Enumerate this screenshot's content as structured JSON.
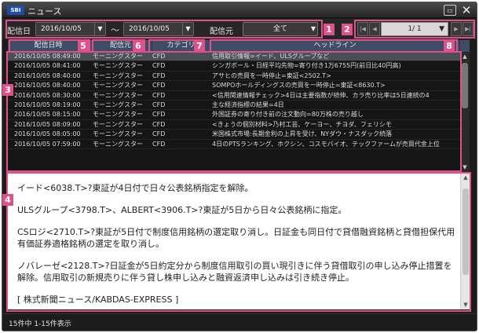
{
  "window": {
    "title": "ニュース",
    "logo": "SBI"
  },
  "filters": {
    "date_label": "配信日",
    "date_from": "2016/10/05",
    "tilde": "〜",
    "date_to": "2016/10/05",
    "source_label": "配信元",
    "source_value": "全て"
  },
  "pager": {
    "value": "1/ 1"
  },
  "columns": [
    "配信日時",
    "配信元",
    "カテゴリ",
    "ヘッドライン"
  ],
  "rows": [
    {
      "date": "2016/10/05 08:49:00",
      "source": "モーニングスター",
      "category": "CFD",
      "headline": "信用取引情報=イード、ULSグループなど",
      "selected": true
    },
    {
      "date": "2016/10/05 08:41:00",
      "source": "モーニングスター",
      "category": "CFD",
      "headline": "シンガポール・日経平均先物=寄り付き1万6755円(前日比40円高)"
    },
    {
      "date": "2016/10/05 08:40:00",
      "source": "モーニングスター",
      "category": "CFD",
      "headline": "アサヒの売買を一時停止=東証<2502.T>"
    },
    {
      "date": "2016/10/05 08:40:00",
      "source": "モーニングスター",
      "category": "CFD",
      "headline": "SOMPOホールディングスの売買を一時停止=東証<8630.T>"
    },
    {
      "date": "2016/10/05 08:30:00",
      "source": "モーニングスター",
      "category": "CFD",
      "headline": "<信用関連情報チェック>4日は主要指数が続伸、カラ売り比率は5日連続の4"
    },
    {
      "date": "2016/10/05 08:19:00",
      "source": "モーニングスター",
      "category": "CFD",
      "headline": "主な経済指標の結果=4日"
    },
    {
      "date": "2016/10/05 08:15:00",
      "source": "モーニングスター",
      "category": "CFD",
      "headline": "外国証券の寄り付き前の注文動向=80万株の売り越し"
    },
    {
      "date": "2016/10/05 08:09:00",
      "source": "モーニングスター",
      "category": "CFD",
      "headline": "<きょうの個別材料>乃村工芸、ケーヨー、チヨダ、フェリシモ"
    },
    {
      "date": "2016/10/05 08:05:00",
      "source": "モーニングスター",
      "category": "CFD",
      "headline": "米国株式市場:長期金利の上昇を受け、NYダウ・ナスダック続落"
    },
    {
      "date": "2016/10/05 07:59:00",
      "source": "モーニングスター",
      "category": "CFD",
      "headline": "4日のPTSランキング、ホクシン、コスモバイオ、テックファームが売買代金上位"
    }
  ],
  "detail": {
    "paragraphs": [
      "イード<6038.T>?東証が4日付で日々公表銘柄指定を解除。",
      "ULSグループ<3798.T>、ALBERT<3906.T>?東証が5日から日々公表銘柄に指定。",
      "CSロジ<2710.T>?東証が5日付で制度信用銘柄の選定取り消し。日証金も同日付で貸借融資銘柄と貸借担保代用有価証券適格銘柄の選定を取り消し。",
      "ノバレーゼ<2128.T>?日証金が5日約定分から制度信用取引の買い現引きに伴う貸借取引の申し込み停止措置を解除。信用取引の新規売りに伴う貸し株申し込みと融資返済申し込みは引き続き停止。",
      "[ 株式新聞ニュース/KABDAS-EXPRESS ]"
    ]
  },
  "status": {
    "text": "15件中 1-15件表示"
  },
  "markers": [
    "1",
    "2",
    "3",
    "4",
    "5",
    "6",
    "7",
    "8"
  ],
  "icons": {
    "restore": "restore-icon",
    "close": "close-icon",
    "dropdown": "chevron-down-icon",
    "first": "first-page-icon",
    "prev": "prev-page-icon",
    "next": "next-page-icon",
    "last": "last-page-icon"
  },
  "colors": {
    "marker": "#e0518c",
    "header": "#3e4c66",
    "selected_row": "#4a4f57"
  }
}
